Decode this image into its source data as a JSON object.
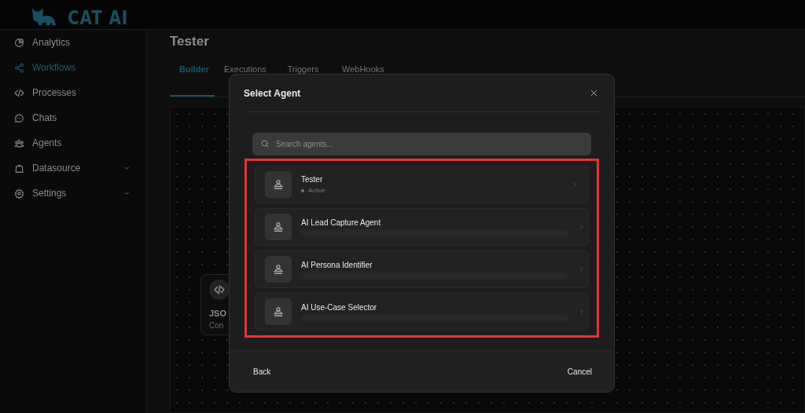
{
  "logo": {
    "text": "CAT AI"
  },
  "sidebar": {
    "items": [
      {
        "label": "Analytics",
        "selected": false,
        "expandable": false
      },
      {
        "label": "Workflows",
        "selected": true,
        "expandable": false
      },
      {
        "label": "Processes",
        "selected": false,
        "expandable": false
      },
      {
        "label": "Chats",
        "selected": false,
        "expandable": false
      },
      {
        "label": "Agents",
        "selected": false,
        "expandable": false
      },
      {
        "label": "Datasource",
        "selected": false,
        "expandable": true
      },
      {
        "label": "Settings",
        "selected": false,
        "expandable": true
      }
    ]
  },
  "page": {
    "title": "Tester",
    "tabs": [
      {
        "label": "Builder",
        "selected": true
      },
      {
        "label": "Executions",
        "selected": false
      },
      {
        "label": "Triggers",
        "selected": false
      },
      {
        "label": "WebHooks",
        "selected": false
      }
    ],
    "node": {
      "title": "JSO",
      "subtitle": "Con"
    }
  },
  "dialog": {
    "title": "Select Agent",
    "search": {
      "placeholder": "Search agents..."
    },
    "agents": [
      {
        "name": "Tester",
        "status": "Active",
        "redacted": false
      },
      {
        "name": "AI Lead Capture Agent",
        "redacted": true
      },
      {
        "name": "AI Persona Identifier",
        "redacted": true
      },
      {
        "name": "AI Use-Case Selector",
        "redacted": true
      }
    ],
    "highlighted": true,
    "buttons": [
      {
        "label": "Back",
        "kind": "back"
      },
      {
        "label": "Cancel",
        "kind": "cancel"
      }
    ]
  }
}
